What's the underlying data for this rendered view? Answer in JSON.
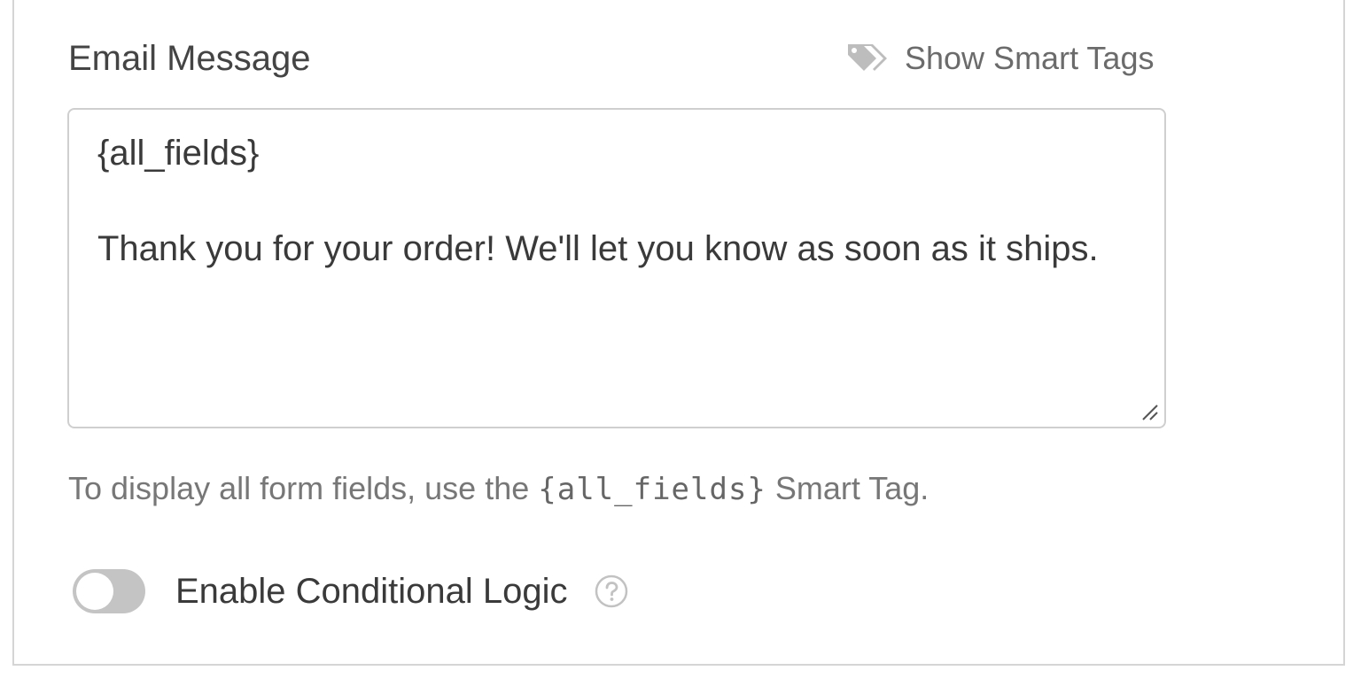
{
  "email_message": {
    "label": "Email Message",
    "smart_tags_link": "Show Smart Tags",
    "textarea_value": "{all_fields}\n\nThank you for your order! We'll let you know as soon as it ships.",
    "help_prefix": "To display all form fields, use the ",
    "help_code": "{all_fields}",
    "help_suffix": " Smart Tag."
  },
  "conditional_logic": {
    "label": "Enable Conditional Logic",
    "enabled": false
  },
  "icons": {
    "tags": "tags-icon",
    "help": "question-circle-icon",
    "resize": "resize-handle-icon"
  },
  "colors": {
    "toggle_off": "#c4c4c4",
    "border": "#cfcfcf",
    "muted_text": "#777777"
  }
}
